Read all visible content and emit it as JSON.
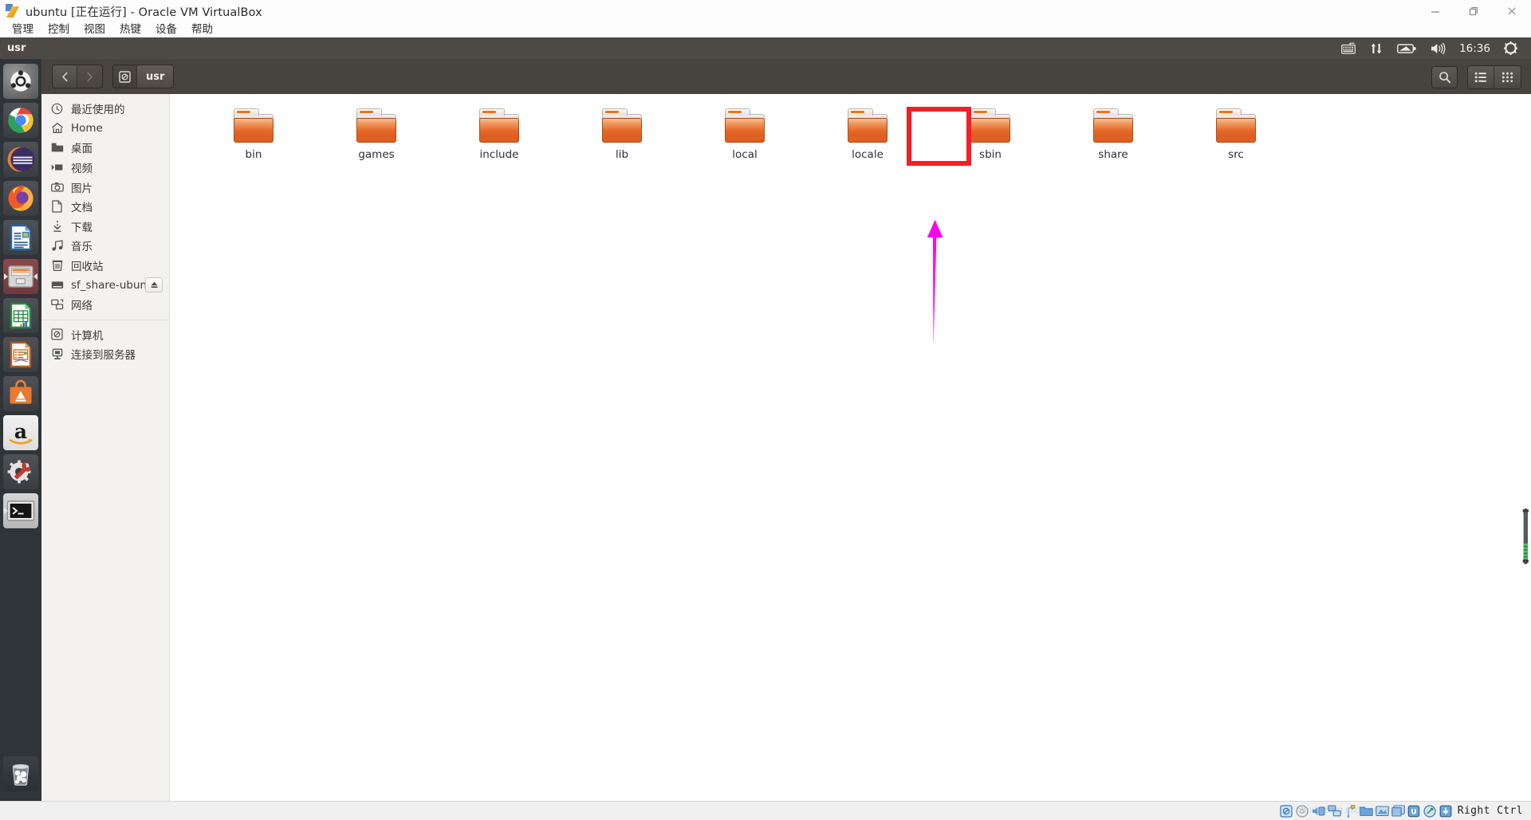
{
  "vbox": {
    "title": "ubuntu [正在运行] - Oracle VM VirtualBox",
    "window_icon": "virtualbox-icon",
    "menus": [
      {
        "label": "管理",
        "name": "menu-manage"
      },
      {
        "label": "控制",
        "name": "menu-machine"
      },
      {
        "label": "视图",
        "name": "menu-view"
      },
      {
        "label": "热键",
        "name": "menu-input"
      },
      {
        "label": "设备",
        "name": "menu-devices"
      },
      {
        "label": "帮助",
        "name": "menu-help"
      }
    ],
    "window_controls": [
      {
        "name": "minimize-button",
        "icon": "minimize-icon"
      },
      {
        "name": "restore-button",
        "icon": "restore-icon"
      },
      {
        "name": "close-button",
        "icon": "close-icon"
      }
    ],
    "statusbar": {
      "host_key": "Right Ctrl",
      "icons": [
        "harddisk-icon",
        "optical-disk-icon",
        "audio-icon",
        "network-icon",
        "usb-icon",
        "shared-folder-icon",
        "display-icon",
        "video-capture-icon",
        "processor-icon",
        "mouse-integration-icon",
        "keyboard-capture-icon"
      ]
    }
  },
  "guest_panel": {
    "app_name": "usr",
    "clock": "16:36",
    "indicators": [
      {
        "name": "keyboard-indicator",
        "icon": "keyboard-icon"
      },
      {
        "name": "network-indicator",
        "icon": "network-updown-icon"
      },
      {
        "name": "battery-indicator",
        "icon": "battery-icon"
      },
      {
        "name": "volume-indicator",
        "icon": "volume-icon"
      },
      {
        "name": "session-indicator",
        "icon": "gear-power-icon"
      }
    ]
  },
  "launcher": {
    "items": [
      {
        "name": "launcher-dash",
        "label": "Ubuntu Dash",
        "icon": "ubuntu-logo-icon",
        "running": false,
        "focused": false
      },
      {
        "name": "launcher-chrome",
        "label": "Google Chrome",
        "icon": "chrome-icon",
        "running": false,
        "focused": false
      },
      {
        "name": "launcher-eclipse",
        "label": "Eclipse",
        "icon": "eclipse-icon",
        "running": false,
        "focused": false
      },
      {
        "name": "launcher-firefox",
        "label": "Firefox",
        "icon": "firefox-icon",
        "running": false,
        "focused": false
      },
      {
        "name": "launcher-writer",
        "label": "LibreOffice Writer",
        "icon": "libreoffice-writer-icon",
        "running": false,
        "focused": false
      },
      {
        "name": "launcher-files",
        "label": "Files",
        "icon": "nautilus-files-icon",
        "running": true,
        "focused": true
      },
      {
        "name": "launcher-calc",
        "label": "LibreOffice Calc",
        "icon": "libreoffice-calc-icon",
        "running": false,
        "focused": false
      },
      {
        "name": "launcher-impress",
        "label": "LibreOffice Impress",
        "icon": "libreoffice-impress-icon",
        "running": false,
        "focused": false
      },
      {
        "name": "launcher-software",
        "label": "Ubuntu Software",
        "icon": "ubuntu-software-icon",
        "running": false,
        "focused": false
      },
      {
        "name": "launcher-amazon",
        "label": "Amazon",
        "icon": "amazon-icon",
        "running": false,
        "focused": false
      },
      {
        "name": "launcher-settings",
        "label": "System Settings",
        "icon": "settings-gear-wrench-icon",
        "running": false,
        "focused": false
      },
      {
        "name": "launcher-terminal",
        "label": "Terminal",
        "icon": "terminal-icon",
        "running": true,
        "focused": false
      }
    ],
    "trash": {
      "name": "launcher-trash",
      "label": "Trash",
      "icon": "trash-icon"
    }
  },
  "nautilus": {
    "toolbar": {
      "back": {
        "name": "back-button",
        "icon": "chevron-left-icon"
      },
      "forward": {
        "name": "forward-button",
        "icon": "chevron-right-icon"
      },
      "breadcrumbs": [
        {
          "label": "",
          "icon": "computer-disk-icon",
          "name": "breadcrumb-computer"
        },
        {
          "label": "usr",
          "name": "breadcrumb-usr"
        }
      ],
      "search": {
        "name": "search-button",
        "icon": "search-icon"
      },
      "view_list": {
        "name": "list-view-button",
        "icon": "list-view-icon"
      },
      "view_grid": {
        "name": "grid-view-button",
        "icon": "grid-view-icon"
      }
    },
    "sidebar": {
      "groups": [
        {
          "items": [
            {
              "label": "最近使用的",
              "icon": "clock-icon",
              "name": "sidebar-item-recent"
            },
            {
              "label": "Home",
              "icon": "home-icon",
              "name": "sidebar-item-home"
            },
            {
              "label": "桌面",
              "icon": "desktop-folder-icon",
              "name": "sidebar-item-desktop"
            },
            {
              "label": "视频",
              "icon": "video-icon",
              "name": "sidebar-item-videos"
            },
            {
              "label": "图片",
              "icon": "camera-icon",
              "name": "sidebar-item-pictures"
            },
            {
              "label": "文档",
              "icon": "document-icon",
              "name": "sidebar-item-documents"
            },
            {
              "label": "下载",
              "icon": "download-icon",
              "name": "sidebar-item-downloads"
            },
            {
              "label": "音乐",
              "icon": "music-note-icon",
              "name": "sidebar-item-music"
            },
            {
              "label": "回收站",
              "icon": "trash-icon",
              "name": "sidebar-item-trash"
            },
            {
              "label": "sf_share-ubuntu",
              "icon": "drive-icon",
              "name": "sidebar-item-sf-share-ubuntu",
              "eject": true
            },
            {
              "label": "网络",
              "icon": "network-icon",
              "name": "sidebar-item-network"
            }
          ]
        },
        {
          "items": [
            {
              "label": "计算机",
              "icon": "computer-disk-icon",
              "name": "sidebar-item-computer"
            },
            {
              "label": "连接到服务器",
              "icon": "connect-server-icon",
              "name": "sidebar-item-connect-to-server"
            }
          ]
        }
      ]
    },
    "files": [
      {
        "label": "bin",
        "icon": "folder-icon",
        "name": "file-item-bin",
        "highlighted": false
      },
      {
        "label": "games",
        "icon": "folder-icon",
        "name": "file-item-games",
        "highlighted": false
      },
      {
        "label": "include",
        "icon": "folder-icon",
        "name": "file-item-include",
        "highlighted": false
      },
      {
        "label": "lib",
        "icon": "folder-icon",
        "name": "file-item-lib",
        "highlighted": false
      },
      {
        "label": "local",
        "icon": "folder-icon",
        "name": "file-item-local",
        "highlighted": false
      },
      {
        "label": "locale",
        "icon": "folder-icon",
        "name": "file-item-locale",
        "highlighted": false
      },
      {
        "label": "sbin",
        "icon": "folder-icon",
        "name": "file-item-sbin",
        "highlighted": false
      },
      {
        "label": "share",
        "icon": "folder-icon",
        "name": "file-item-share",
        "highlighted": true
      },
      {
        "label": "src",
        "icon": "folder-icon",
        "name": "file-item-src",
        "highlighted": false
      }
    ]
  },
  "annotations": {
    "highlight_color": "#f41d28",
    "arrow_color": "#ff00f0",
    "target_label": "share"
  }
}
